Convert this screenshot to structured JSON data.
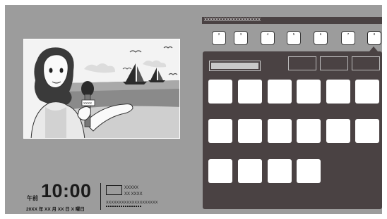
{
  "clock": {
    "ampm": "午前",
    "time": "10:00",
    "date": "20XX 年 XX 月 XX 日 X 曜日"
  },
  "program": {
    "line1": "XXXXX",
    "line2": "XX XXXX",
    "line3": "XXXXXXXXXXXXXXXXXXXX"
  },
  "header": {
    "title": "XXXXXXXXXXXXXXXXXXXX"
  },
  "channels": [
    "2",
    "3",
    "4",
    "5",
    "6",
    "7",
    "8"
  ],
  "selected_channel": "8",
  "video": {
    "mic_label": "XXXX"
  },
  "colors": {
    "background": "#9c9c9c",
    "panel": "#4a4243",
    "tile": "#ffffff"
  }
}
